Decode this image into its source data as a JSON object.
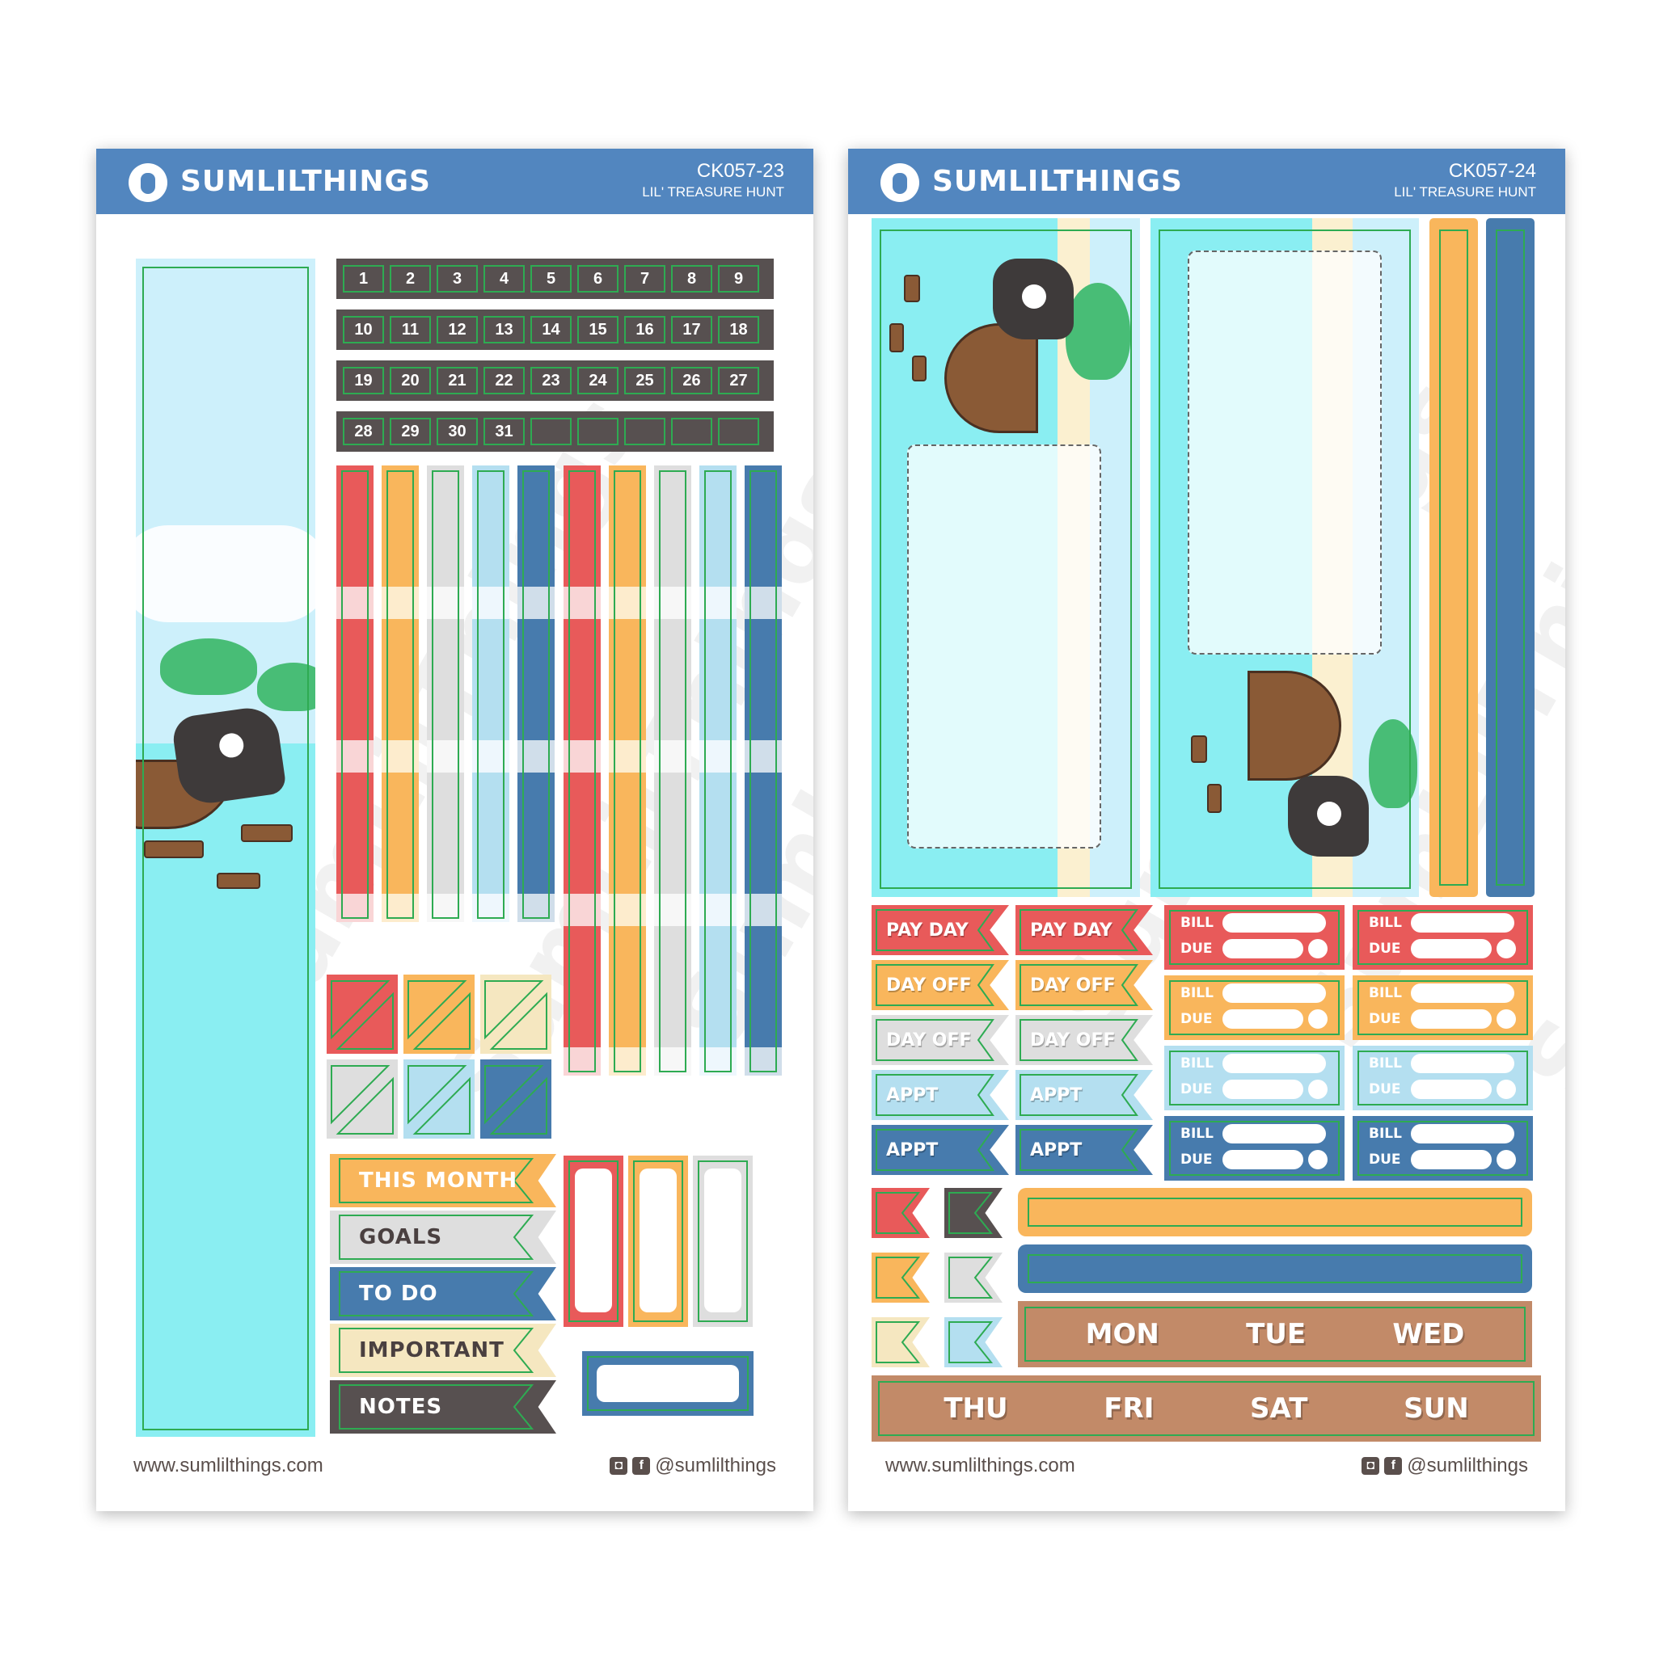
{
  "colors": {
    "header_blue": "#5286bf",
    "red": "#e85a5a",
    "orange": "#f9b65c",
    "grey": "#dedede",
    "light_blue": "#b4dff0",
    "blue": "#477bad",
    "cream": "#f5e7c0",
    "charcoal": "#575050",
    "brown": "#c28a68",
    "cut_line_green": "#2eab52",
    "text_dark": "#4a4040"
  },
  "sheets": [
    {
      "brand": "SUMLILTHINGS",
      "code": "CK057-23",
      "subtitle": "LIL' TREASURE HUNT",
      "website": "www.sumlilthings.com",
      "social_handle": "@sumlilthings",
      "social_icons": [
        "instagram-icon",
        "facebook-icon"
      ],
      "date_rows": [
        [
          "1",
          "2",
          "3",
          "4",
          "5",
          "6",
          "7",
          "8",
          "9"
        ],
        [
          "10",
          "11",
          "12",
          "13",
          "14",
          "15",
          "16",
          "17",
          "18"
        ],
        [
          "19",
          "20",
          "21",
          "22",
          "23",
          "24",
          "25",
          "26",
          "27"
        ],
        [
          "28",
          "29",
          "30",
          "31",
          "",
          "",
          "",
          "",
          ""
        ]
      ],
      "stripe_colors": [
        "red",
        "orange",
        "grey",
        "light_blue",
        "blue"
      ],
      "diagonal_square_colors": [
        "red",
        "orange",
        "cream",
        "grey",
        "light_blue",
        "blue"
      ],
      "flags": [
        {
          "label": "THIS MONTH",
          "color": "orange",
          "text_color": "#ffffff"
        },
        {
          "label": "GOALS",
          "color": "grey",
          "text_color": "#4a4040"
        },
        {
          "label": "TO DO",
          "color": "blue",
          "text_color": "#ffffff"
        },
        {
          "label": "IMPORTANT",
          "color": "cream",
          "text_color": "#4a4040"
        },
        {
          "label": "NOTES",
          "color": "charcoal",
          "text_color": "#ffffff"
        }
      ],
      "box_colors": [
        "red",
        "orange",
        "grey"
      ],
      "label_box_color": "blue"
    },
    {
      "brand": "SUMLILTHINGS",
      "code": "CK057-24",
      "subtitle": "LIL' TREASURE HUNT",
      "website": "www.sumlilthings.com",
      "social_handle": "@sumlilthings",
      "social_icons": [
        "instagram-icon",
        "facebook-icon"
      ],
      "flag_columns": [
        [
          {
            "label": "PAY DAY",
            "color": "red"
          },
          {
            "label": "DAY OFF",
            "color": "orange"
          },
          {
            "label": "DAY OFF",
            "color": "grey"
          },
          {
            "label": "APPT",
            "color": "light_blue"
          },
          {
            "label": "APPT",
            "color": "blue"
          }
        ],
        [
          {
            "label": "PAY DAY",
            "color": "red"
          },
          {
            "label": "DAY OFF",
            "color": "orange"
          },
          {
            "label": "DAY OFF",
            "color": "grey"
          },
          {
            "label": "APPT",
            "color": "light_blue"
          },
          {
            "label": "APPT",
            "color": "blue"
          }
        ]
      ],
      "bill_labels": {
        "bill": "BILL",
        "due": "DUE"
      },
      "bill_colors": [
        "red",
        "orange",
        "light_blue",
        "blue"
      ],
      "mini_flag_colors": [
        "red",
        "charcoal",
        "orange",
        "grey",
        "cream",
        "light_blue"
      ],
      "bar_colors": [
        "orange",
        "blue"
      ],
      "days_row_1": [
        "MON",
        "TUE",
        "WED"
      ],
      "days_row_2": [
        "THU",
        "FRI",
        "SAT",
        "SUN"
      ],
      "strip_colors": [
        "orange",
        "blue"
      ]
    }
  ],
  "watermark": "SumLilThings"
}
